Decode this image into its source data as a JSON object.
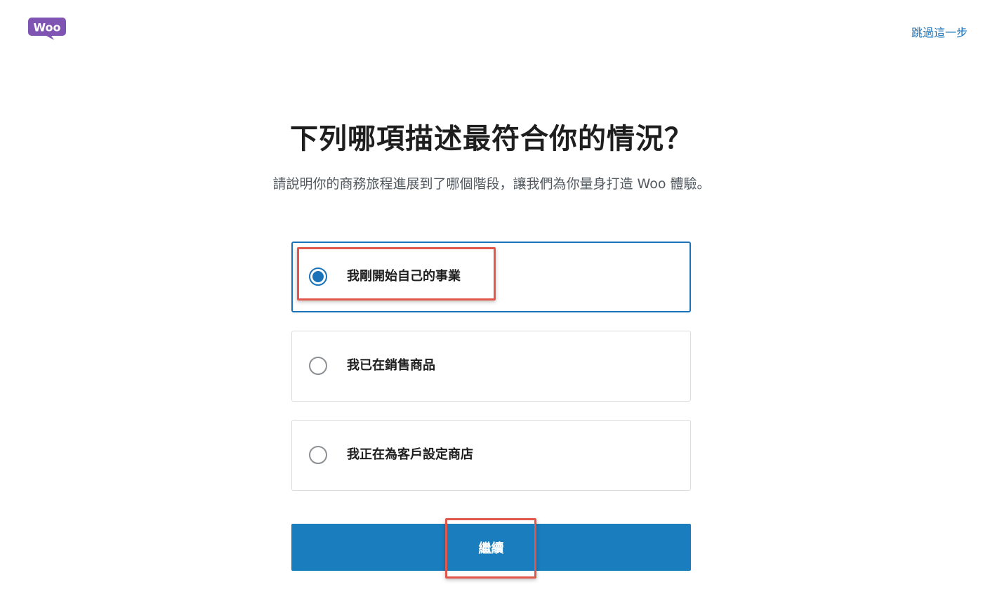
{
  "header": {
    "logo_text": "Woo",
    "brand_color": "#7f54b3",
    "skip_label": "跳過這一步"
  },
  "main": {
    "title": "下列哪項描述最符合你的情況？",
    "subtitle": "請說明你的商務旅程進展到了哪個階段，讓我們為你量身打造 Woo 體驗。",
    "options": [
      {
        "label": "我剛開始自己的事業",
        "selected": true
      },
      {
        "label": "我已在銷售商品",
        "selected": false
      },
      {
        "label": "我正在為客戶設定商店",
        "selected": false
      }
    ],
    "continue_label": "繼續"
  },
  "colors": {
    "accent": "#1a73b8",
    "button": "#1a7dbd",
    "highlight": "#e2574c"
  }
}
